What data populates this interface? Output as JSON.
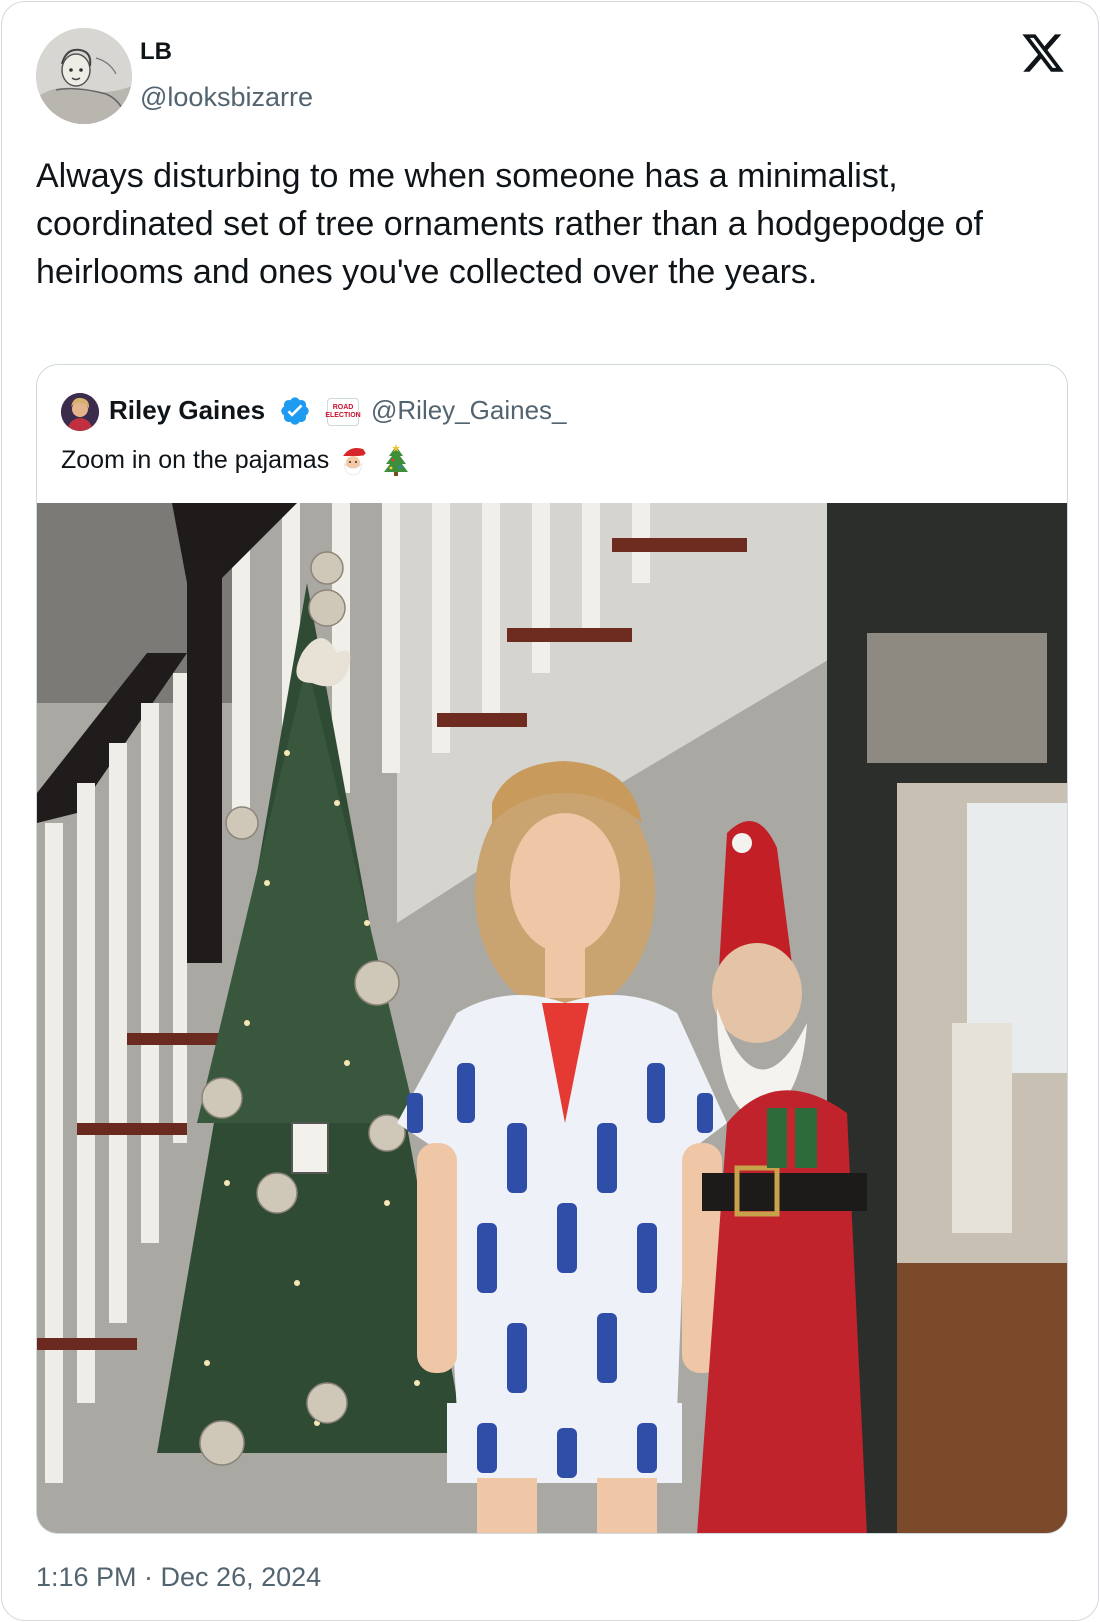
{
  "author": {
    "display_name": "LB",
    "handle": "@looksbizarre",
    "avatar_icon": "avatar-sketch"
  },
  "platform_icon": "x-logo-icon",
  "tweet": {
    "text": "Always disturbing to me when someone has a minimalist, coordinated set of tree ornaments rather than a hodgepodge of heirlooms and ones you've collected over the years.",
    "timestamp": "1:16 PM · Dec 26, 2024"
  },
  "quoted": {
    "display_name": "Riley Gaines",
    "handle": "@Riley_Gaines_",
    "verified": true,
    "verified_color": "#1d9bf0",
    "affiliate_badge_text": "ROAD ELECTION",
    "text": "Zoom in on the pajamas",
    "emoji": [
      "santa-emoji",
      "christmas-tree-emoji"
    ],
    "media_alt_icon": "photo"
  },
  "colors": {
    "text": "#0f1419",
    "secondary": "#536471",
    "border": "#cfd9de"
  }
}
